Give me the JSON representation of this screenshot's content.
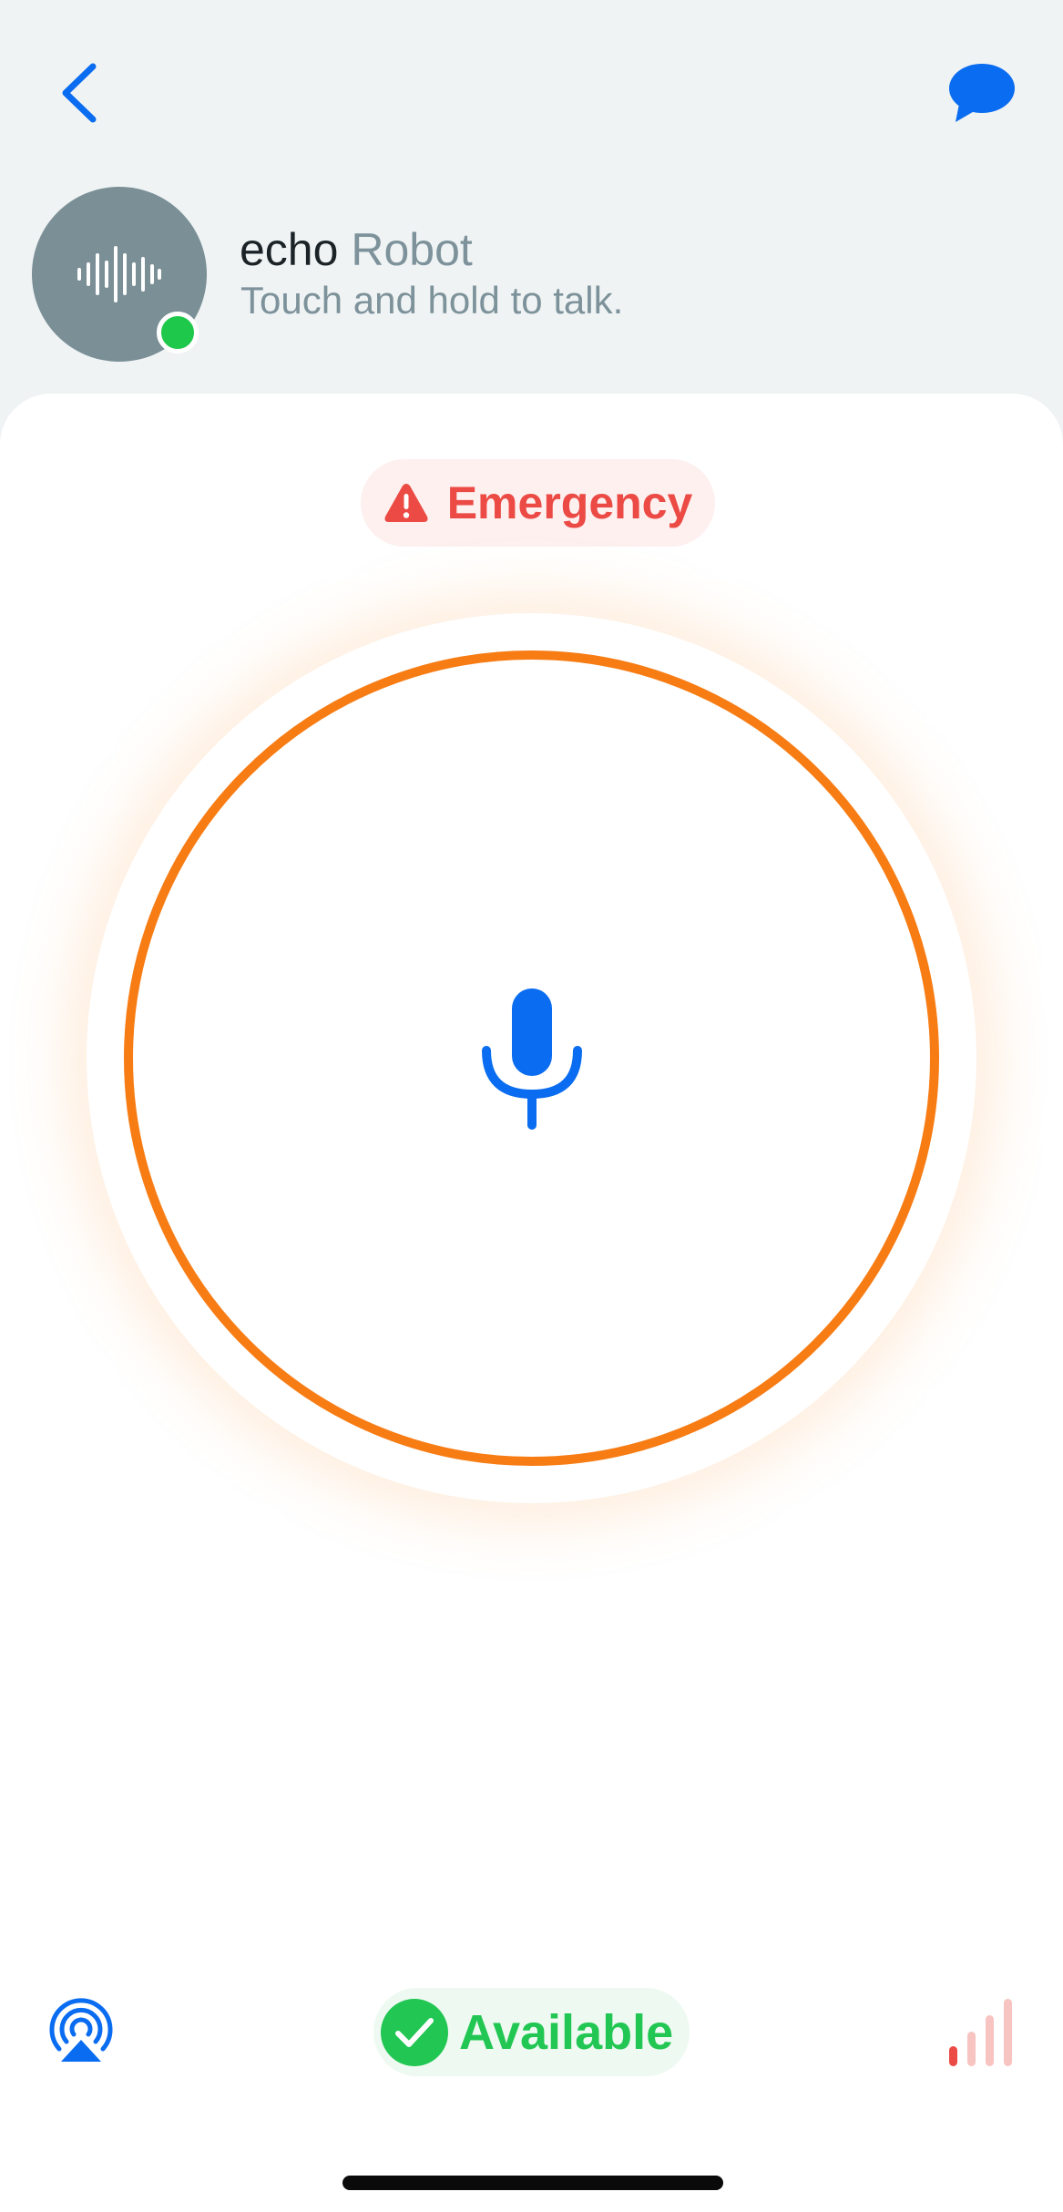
{
  "header": {
    "back_icon": "chevron-left-icon",
    "chat_icon": "chat-bubble-icon",
    "contact_name": "echo",
    "contact_type": "Robot",
    "subtitle": "Touch and hold to talk.",
    "avatar_icon": "audio-waveform-icon",
    "presence": "online"
  },
  "emergency": {
    "label": "Emergency",
    "icon": "warning-triangle-icon"
  },
  "talk_button": {
    "icon": "microphone-icon"
  },
  "footer": {
    "airplay_icon": "airplay-icon",
    "status_label": "Available",
    "status_icon": "checkmark-icon",
    "signal_icon": "signal-strength-icon",
    "signal_bars_active": 1,
    "signal_bars_total": 4
  },
  "colors": {
    "accent_blue": "#0a6cf0",
    "ring_orange": "#f77c14",
    "emergency_red": "#ec4a44",
    "available_green": "#22c653",
    "avatar_gray": "#7a8f96",
    "header_bg": "#eff3f4"
  }
}
